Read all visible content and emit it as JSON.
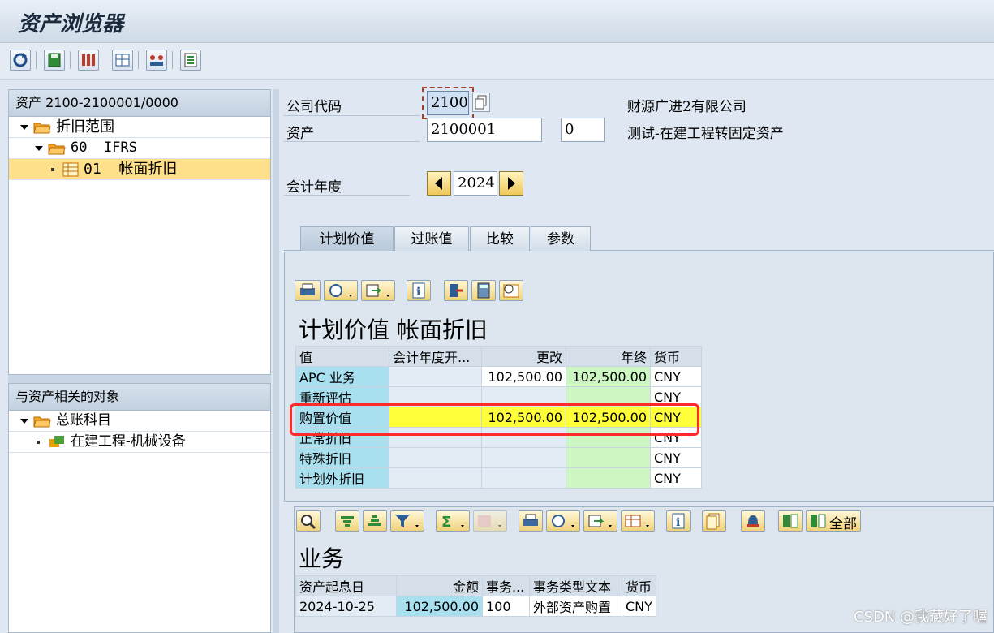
{
  "window": {
    "title": "资产浏览器"
  },
  "toolbar": {
    "icons": [
      "refresh-icon",
      "save-icon",
      "multi-select-icon",
      "layout-icon",
      "group-icon",
      "list-icon"
    ]
  },
  "tree1": {
    "header": "资产 2100-2100001/0000",
    "items": [
      {
        "label": "折旧范围"
      },
      {
        "label": "60  IFRS"
      },
      {
        "label": "01  帐面折旧"
      }
    ]
  },
  "tree2": {
    "header": "与资产相关的对象",
    "items": [
      {
        "label": "总账科目"
      },
      {
        "label": "在建工程-机械设备"
      }
    ]
  },
  "fields": {
    "company_code_label": "公司代码",
    "company_code_value": "2100",
    "company_name": "财源广进2有限公司",
    "asset_label": "资产",
    "asset_value": "2100001",
    "asset_sub": "0",
    "asset_desc": "测试-在建工程转固定资产",
    "fiscal_year_label": "会计年度",
    "fiscal_year_value": "2024"
  },
  "tabs": [
    "计划价值",
    "过账值",
    "比较",
    "参数"
  ],
  "grid1": {
    "title": "计划价值 帐面折旧",
    "columns": [
      "值",
      "会计年度开...",
      "更改",
      "年终",
      "货币"
    ],
    "rows": [
      [
        "APC 业务",
        "",
        "102,500.00",
        "102,500.00",
        "CNY"
      ],
      [
        "重新评估",
        "",
        "",
        "",
        "CNY"
      ],
      [
        "购置价值",
        "",
        "102,500.00",
        "102,500.00",
        "CNY"
      ],
      [
        "正常折旧",
        "",
        "",
        "",
        "CNY"
      ],
      [
        "特殊折旧",
        "",
        "",
        "",
        "CNY"
      ],
      [
        "计划外折旧",
        "",
        "",
        "",
        "CNY"
      ]
    ]
  },
  "grid2": {
    "title": "业务",
    "all_label": "全部",
    "columns": [
      "资产起息日",
      "金额",
      "事务...",
      "事务类型文本",
      "货币"
    ],
    "rows": [
      [
        "2024-10-25",
        "102,500.00",
        "100",
        "外部资产购置",
        "CNY"
      ]
    ]
  },
  "watermark": "CSDN @我藏好了喔",
  "colors": {
    "highlight": "#ff2a2a",
    "yellow_row": "#ffff3a",
    "cyan_col": "#a9e0f0",
    "green_col": "#ccf6c2"
  }
}
